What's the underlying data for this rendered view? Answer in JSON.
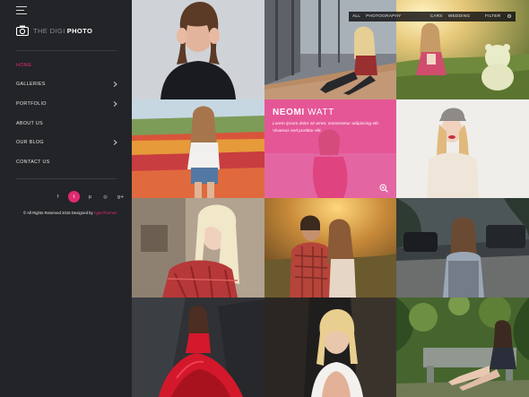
{
  "logo": {
    "prefix": "THE DIGI",
    "name": "PHOTO"
  },
  "nav": [
    {
      "label": "HOME",
      "active": true,
      "has_submenu": false
    },
    {
      "label": "GALLERIES",
      "active": false,
      "has_submenu": true
    },
    {
      "label": "PORTFOLIO",
      "active": false,
      "has_submenu": true
    },
    {
      "label": "ABOUT US",
      "active": false,
      "has_submenu": false
    },
    {
      "label": "OUR BLOG",
      "active": false,
      "has_submenu": true
    },
    {
      "label": "CONTACT US",
      "active": false,
      "has_submenu": false
    }
  ],
  "social": [
    {
      "icon": "facebook-icon",
      "glyph": "f"
    },
    {
      "icon": "twitter-icon",
      "glyph": "t"
    },
    {
      "icon": "pinterest-icon",
      "glyph": "p"
    },
    {
      "icon": "dribbble-icon",
      "glyph": "◎"
    },
    {
      "icon": "google-plus-icon",
      "glyph": "g+"
    }
  ],
  "footer": {
    "copyright": "© All Rights Reserved 2016 Designed by",
    "designer": "AgenThemes"
  },
  "filter": {
    "all": "ALL",
    "categories": [
      "PHOTOGRAPHY",
      "CARS",
      "WEDDING"
    ],
    "filter_label": "FILTER",
    "settings_glyph": "⚙"
  },
  "featured": {
    "title_first": "NEOMI",
    "title_last": "WATT",
    "desc": "Lorem ipsum dolor sit amet, consectetur adipiscing elit. Vivamus sed porttitor elit."
  },
  "colors": {
    "accent": "#e02a71",
    "sidebar_bg": "#232428",
    "featured_overlay": "#e8478f"
  }
}
